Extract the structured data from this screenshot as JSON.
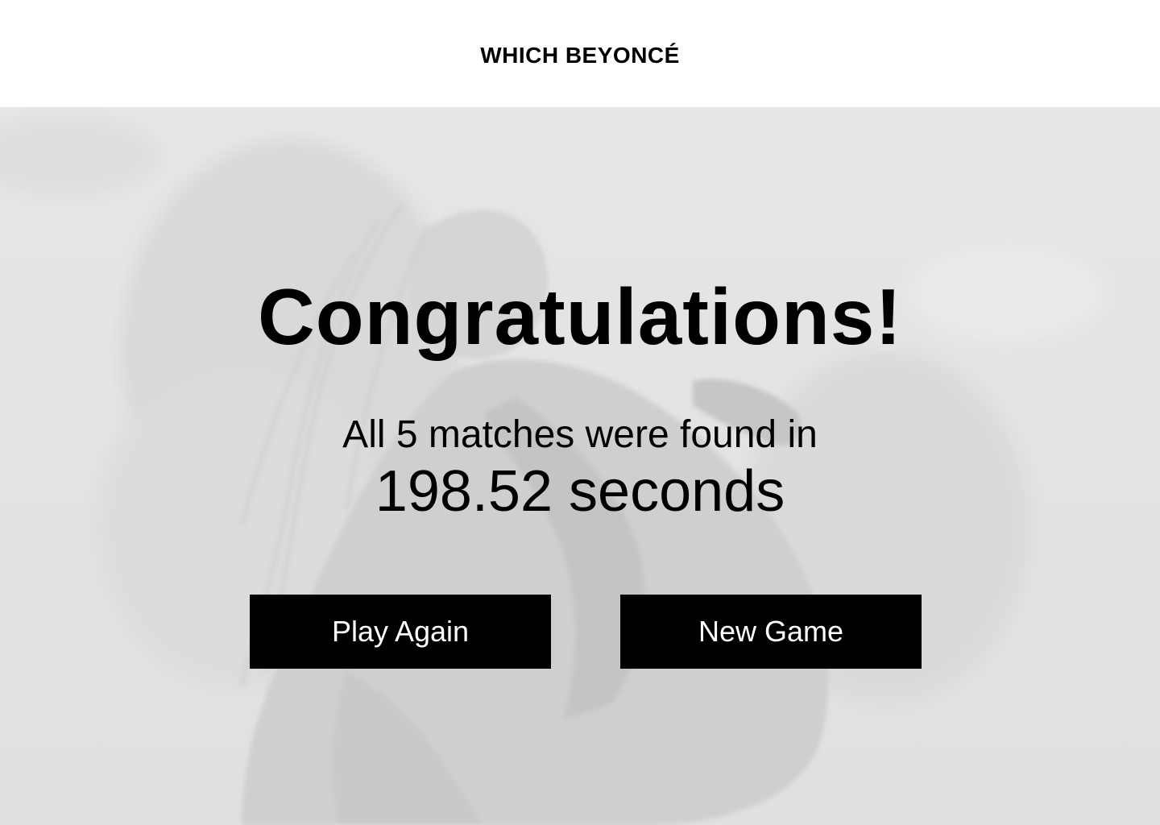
{
  "header": {
    "title": "WHICH BEYONCÉ"
  },
  "result": {
    "headline": "Congratulations!",
    "summary": "All 5 matches were found in",
    "time": "198.52 seconds"
  },
  "actions": {
    "play_again_label": "Play Again",
    "new_game_label": "New Game"
  },
  "background": {
    "description_icon": "performer-photo-background"
  }
}
